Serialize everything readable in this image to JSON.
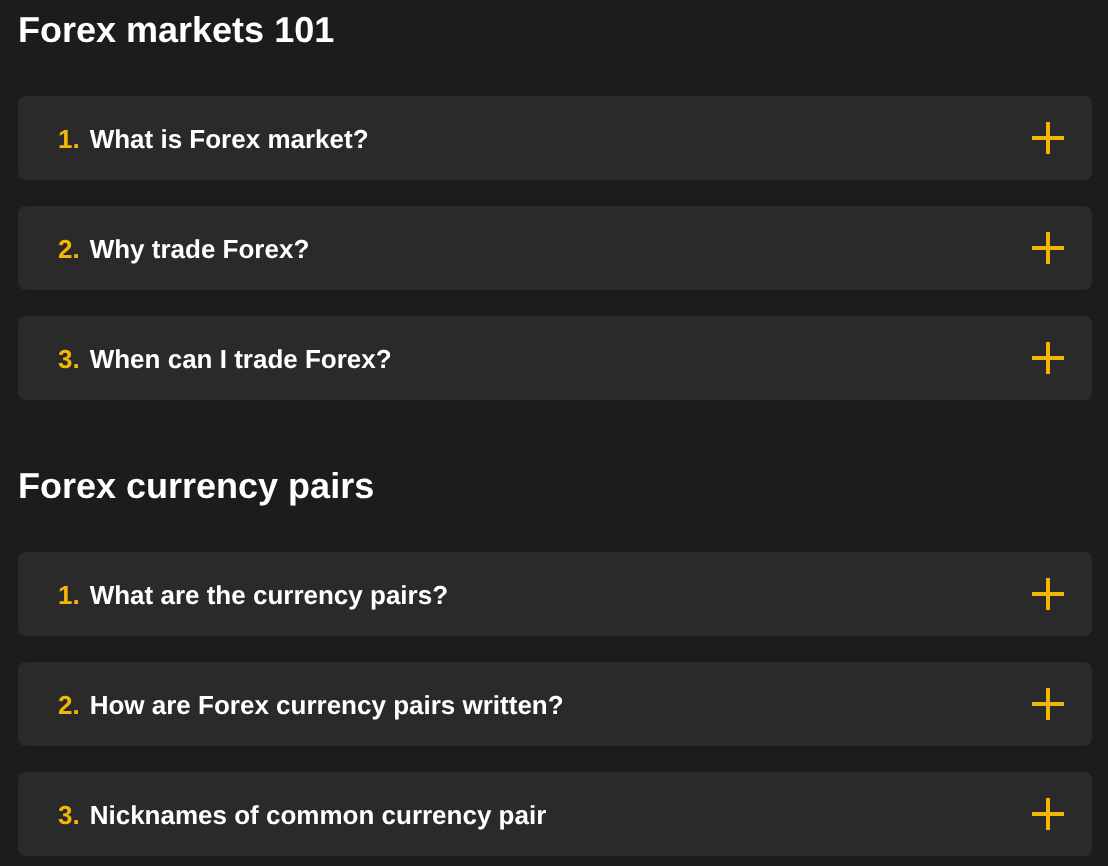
{
  "sections": [
    {
      "title": "Forex markets 101",
      "items": [
        {
          "number": "1.",
          "question": "What is Forex market?",
          "expanded": false
        },
        {
          "number": "2.",
          "question": "Why trade Forex?",
          "expanded": false
        },
        {
          "number": "3.",
          "question": "When can I trade Forex?",
          "expanded": false
        }
      ]
    },
    {
      "title": "Forex currency pairs",
      "items": [
        {
          "number": "1.",
          "question": "What are the currency pairs?",
          "expanded": false
        },
        {
          "number": "2.",
          "question": "How are Forex currency pairs written?",
          "expanded": false
        },
        {
          "number": "3.",
          "question": "Nicknames of common currency pair",
          "expanded": false
        }
      ]
    }
  ]
}
